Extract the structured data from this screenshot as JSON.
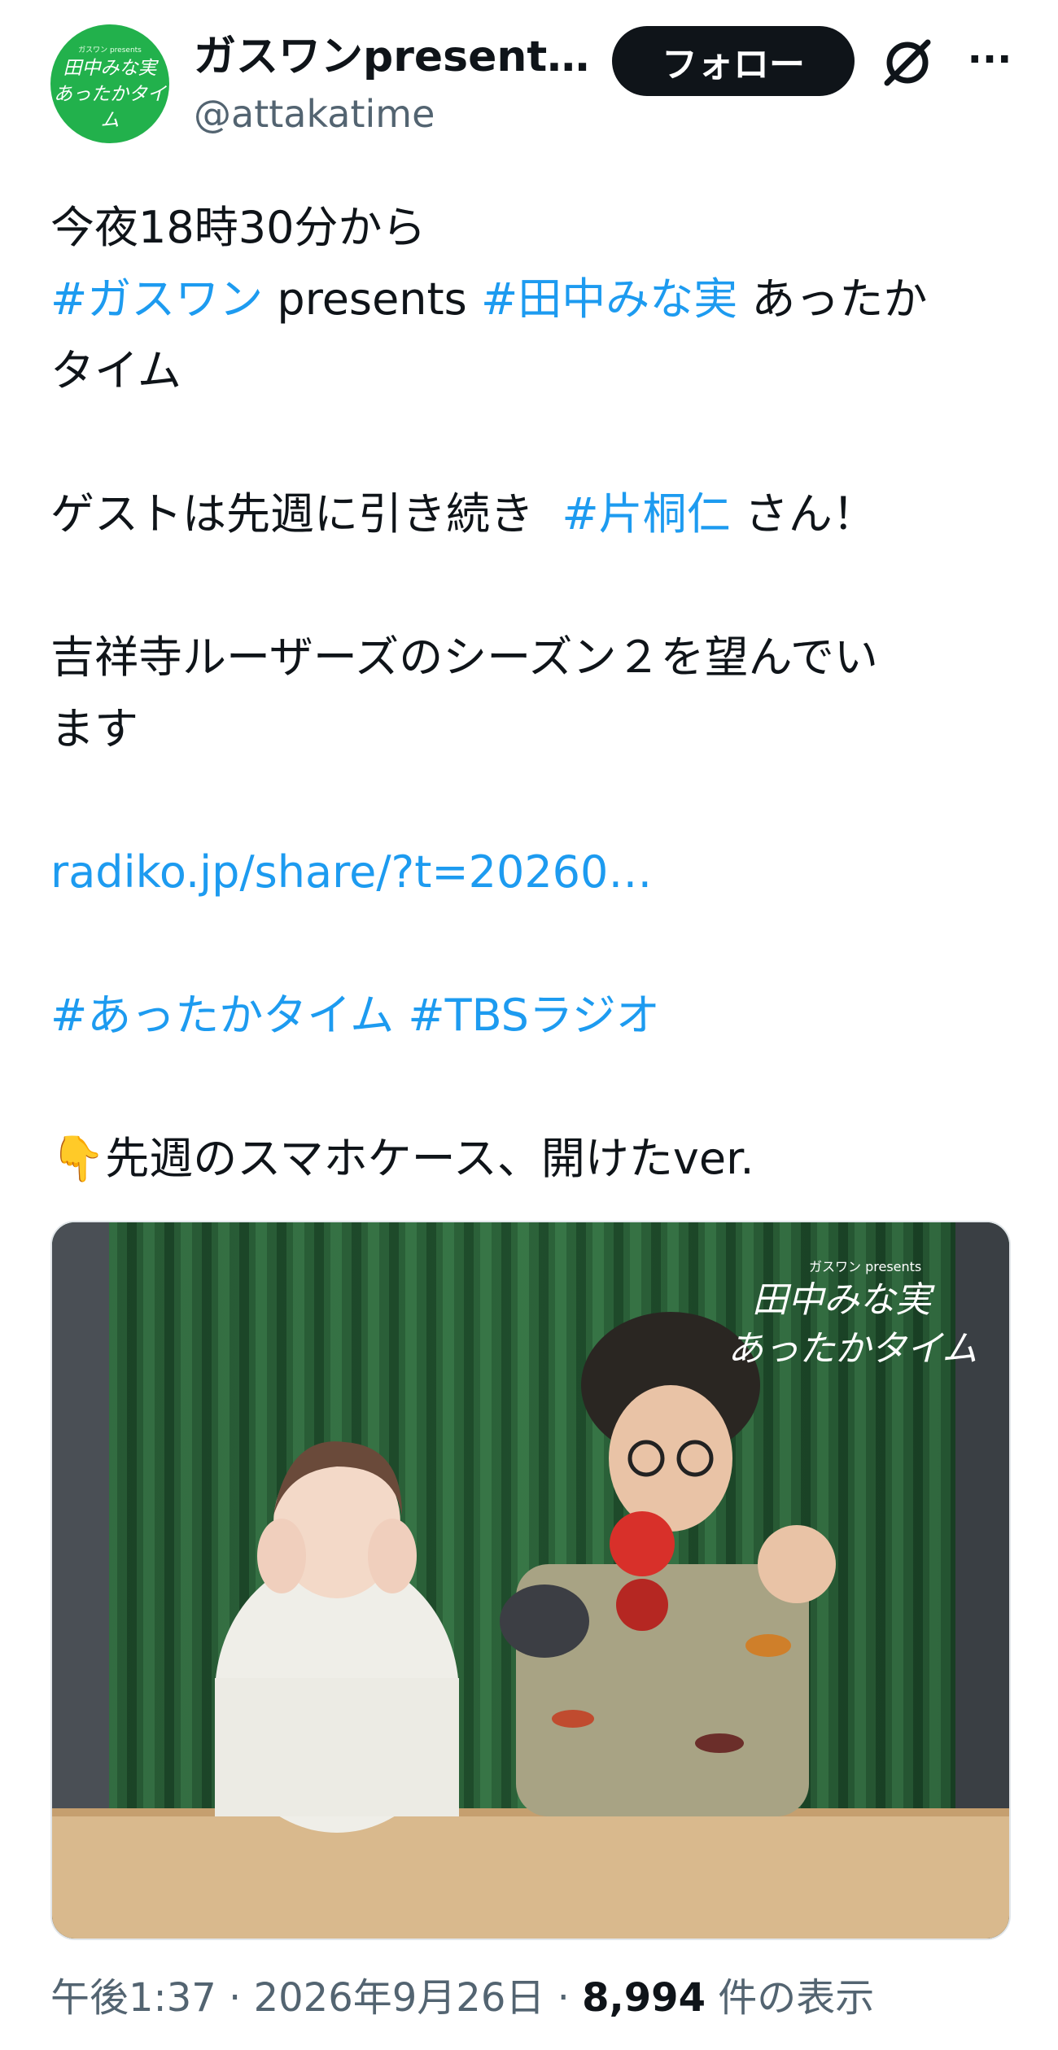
{
  "account": {
    "display_name": "ガスワンpresents…",
    "handle": "@attakatime",
    "avatar_small_text": "ガスワン presents",
    "avatar_text_line1": "田中みな実",
    "avatar_text_line2": "あったかタイム",
    "follow_label": "フォロー"
  },
  "tweet": {
    "line1": "今夜18時30分から",
    "tag_gaswan": "#ガスワン",
    "presents": " presents ",
    "tag_tanaka": "#田中みな実",
    "after_tanaka": " あったか",
    "line3": "タイム",
    "guest_prefix": "ゲストは先週に引き続き  ",
    "tag_kataginri": "#片桐仁",
    "guest_suffix": " さん！",
    "season_line1": "吉祥寺ルーザーズのシーズン２を望んでい",
    "season_line2": "ます",
    "link": "radiko.jp/share/?t=20260…",
    "tag_attaka": "#あったかタイム",
    "tag_tbs": "#TBSラジオ",
    "finger_emoji": "👇",
    "last_line": "先週のスマホケース、開けたver."
  },
  "photo": {
    "watermark_small": "ガスワン presents",
    "watermark_line1": "田中みな実",
    "watermark_line2": "あったかタイム"
  },
  "meta": {
    "time": "午後1:37",
    "sep1": " · ",
    "date": "2026年9月26日",
    "sep2": " · ",
    "views": "8,994",
    "views_suffix": " 件の表示"
  },
  "colors": {
    "link": "#1d9bf0",
    "avatar_bg": "#22b14c",
    "follow_bg": "#0f1419",
    "secondary_text": "#536471"
  }
}
